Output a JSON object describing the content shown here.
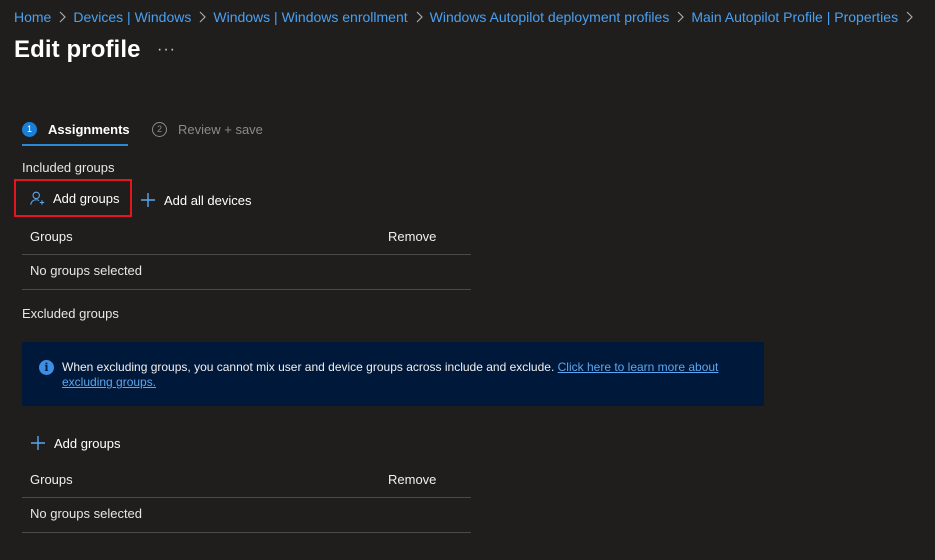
{
  "breadcrumb": {
    "items": [
      "Home",
      "Devices | Windows",
      "Windows | Windows enrollment",
      "Windows Autopilot deployment profiles",
      "Main Autopilot Profile | Properties"
    ]
  },
  "page": {
    "title": "Edit profile",
    "more": "···"
  },
  "wizard": {
    "steps": [
      {
        "number": "1",
        "label": "Assignments"
      },
      {
        "number": "2",
        "label": "Review + save"
      }
    ]
  },
  "included": {
    "label": "Included groups",
    "add_groups": "Add groups",
    "add_all_devices": "Add all devices",
    "table": {
      "col_groups": "Groups",
      "col_remove": "Remove",
      "empty": "No groups selected"
    }
  },
  "excluded": {
    "label": "Excluded groups",
    "info_text": "When excluding groups, you cannot mix user and device groups across include and exclude.",
    "info_link": "Click here to learn more about excluding groups.",
    "add_groups": "Add groups",
    "table": {
      "col_groups": "Groups",
      "col_remove": "Remove",
      "empty": "No groups selected"
    }
  },
  "colors": {
    "accent": "#2b88d8",
    "link": "#4aa0f0",
    "highlight": "#e3151d",
    "banner": "#00193a"
  }
}
